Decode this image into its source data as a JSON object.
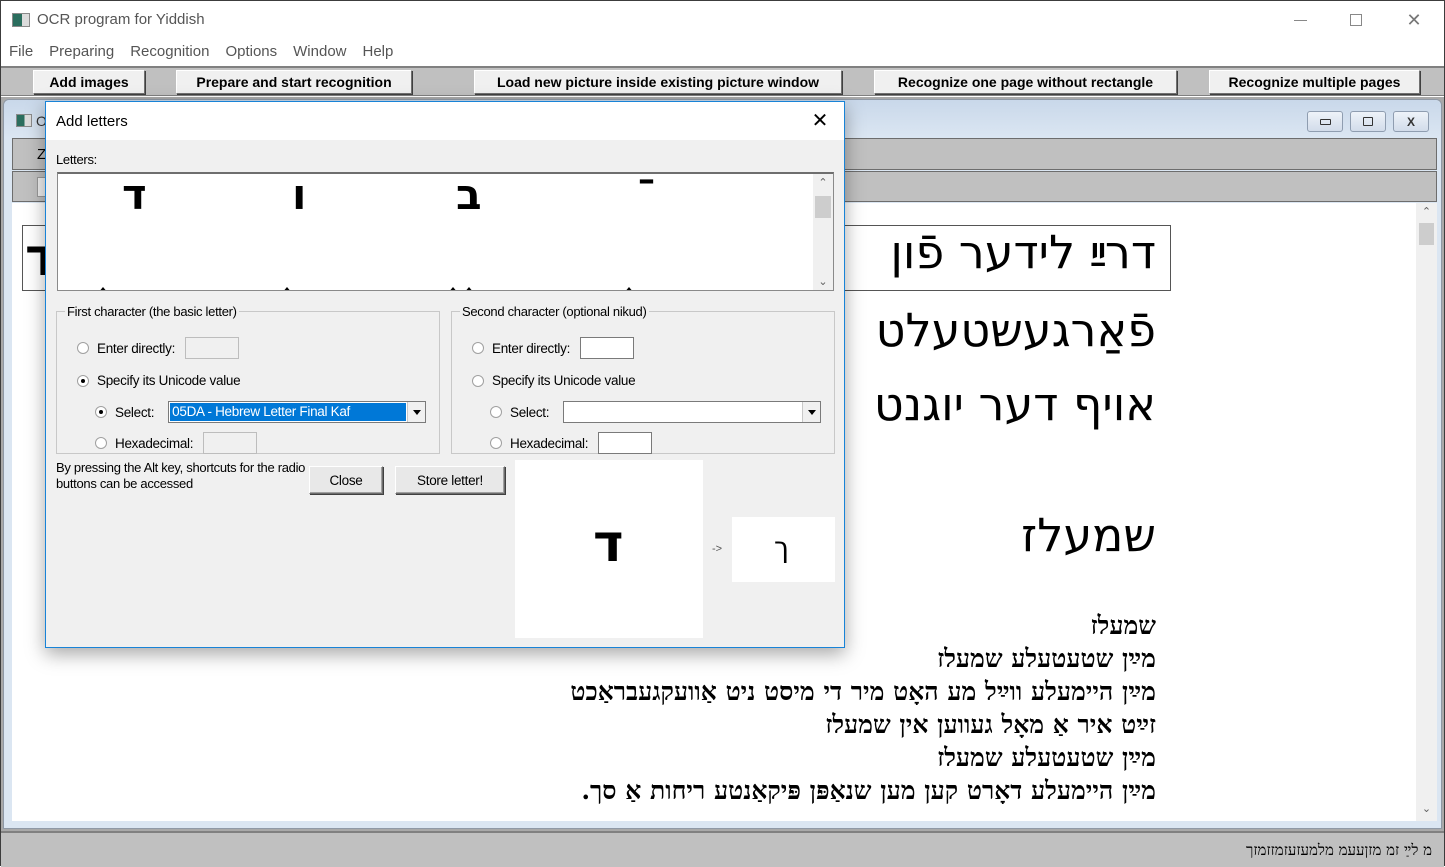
{
  "window": {
    "title": "OCR program for Yiddish",
    "controls": {
      "minimize": "—",
      "maximize": "☐",
      "close": "✕"
    }
  },
  "menubar": [
    "File",
    "Preparing",
    "Recognition",
    "Options",
    "Window",
    "Help"
  ],
  "toolbar": {
    "add_images": "Add images",
    "prepare_start": "Prepare and start recognition",
    "load_new_picture": "Load new picture inside existing picture window",
    "recognize_one_page": "Recognize one page without rectangle",
    "recognize_multiple": "Recognize multiple pages"
  },
  "child_window": {
    "title_partial": "O",
    "toolbar_label_partial": "Z",
    "document_lines_large": [
      "דרײַ לידער פֿון",
      "פֿאַרגעשטעלט",
      "אויף דער יוגנט",
      "שמעלז"
    ],
    "first_line_left_char": "ד",
    "document_lines_small": [
      "שמעלז",
      "מײַן שטעטעלע שמעלז",
      "מײַן היימעלע ווײַל מע האָט מיר די מיסט ניט אַוועקגעבראַכט",
      "זײַט איר אַ מאָל געווען אין שמעלז",
      "מײַן שטעטעלע שמעלז",
      "מײַן היימעלע דאָרט קען מען שנאַפּן פּיקאַנטע ריחות אַ סך."
    ]
  },
  "statusbar": {
    "text": "מ לײַ זמ מזןעעמ מלמעזעזמזזמזך"
  },
  "dialog": {
    "title": "Add letters",
    "close_glyph": "✕",
    "letters_label": "Letters:",
    "letters": [
      "ד",
      "ו",
      "ב",
      "ֿ"
    ],
    "first_group": {
      "legend": "First character (the basic letter)",
      "enter_directly_label": "Enter directly:",
      "enter_directly_value": "",
      "specify_unicode_label": "Specify its Unicode value",
      "specify_unicode_selected": true,
      "select_label": "Select:",
      "select_selected": true,
      "select_value": "05DA - Hebrew Letter Final Kaf",
      "hexadecimal_label": "Hexadecimal:",
      "hexadecimal_value": ""
    },
    "second_group": {
      "legend": "Second character (optional nikud)",
      "enter_directly_label": "Enter directly:",
      "enter_directly_value": "",
      "specify_unicode_label": "Specify its Unicode value",
      "specify_unicode_selected": false,
      "select_label": "Select:",
      "select_selected": false,
      "select_value": "",
      "hexadecimal_label": "Hexadecimal:",
      "hexadecimal_value": ""
    },
    "hint": "By pressing the Alt key, shortcuts for the radio buttons can be accessed",
    "close_button": "Close",
    "store_button": "Store letter!",
    "preview_source_glyph": "ד",
    "arrow_label": "->",
    "preview_result_glyph": "ך"
  }
}
